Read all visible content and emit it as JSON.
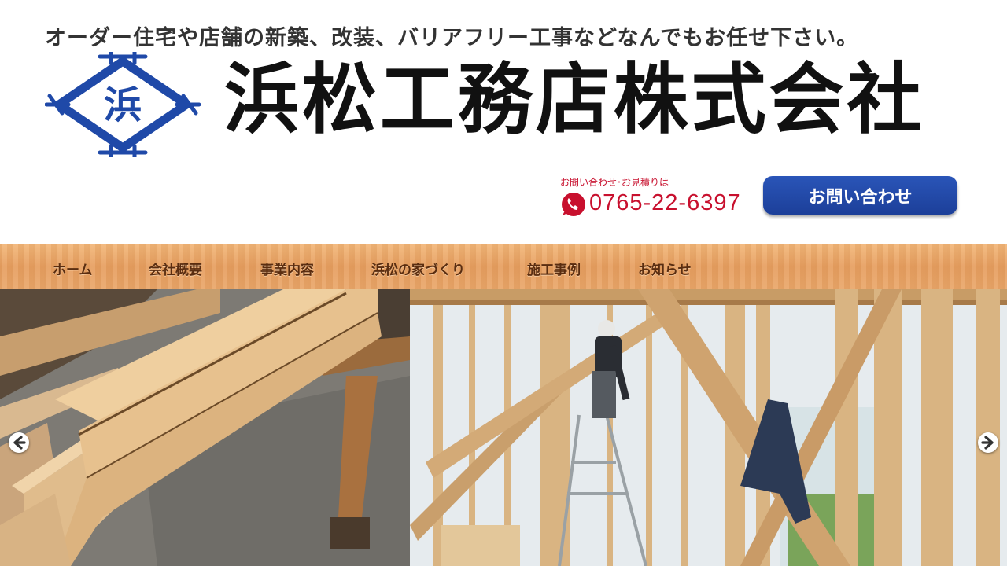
{
  "header": {
    "tagline": "オーダー住宅や店舗の新築、改装、バリアフリー工事などなんでもお任せ下さい。",
    "logo_icon": "hama-diamond-crest",
    "company_name": "浜松工務店株式会社"
  },
  "contact": {
    "label": "お問い合わせ･お見積りは",
    "phone_icon": "phone-icon",
    "phone": "0765-22-6397",
    "button_label": "お問い合わせ"
  },
  "nav": {
    "items": [
      {
        "label": "ホーム"
      },
      {
        "label": "会社概要"
      },
      {
        "label": "事業内容"
      },
      {
        "label": "浜松の家づくり"
      },
      {
        "label": "施工事例"
      },
      {
        "label": "お知らせ"
      }
    ]
  },
  "hero": {
    "prev_icon": "arrow-left-icon",
    "next_icon": "arrow-right-icon"
  },
  "colors": {
    "brand_blue": "#1f49a8",
    "phone_red": "#c8102e",
    "nav_wood": "#eba46a",
    "nav_text": "#5a2d10"
  }
}
